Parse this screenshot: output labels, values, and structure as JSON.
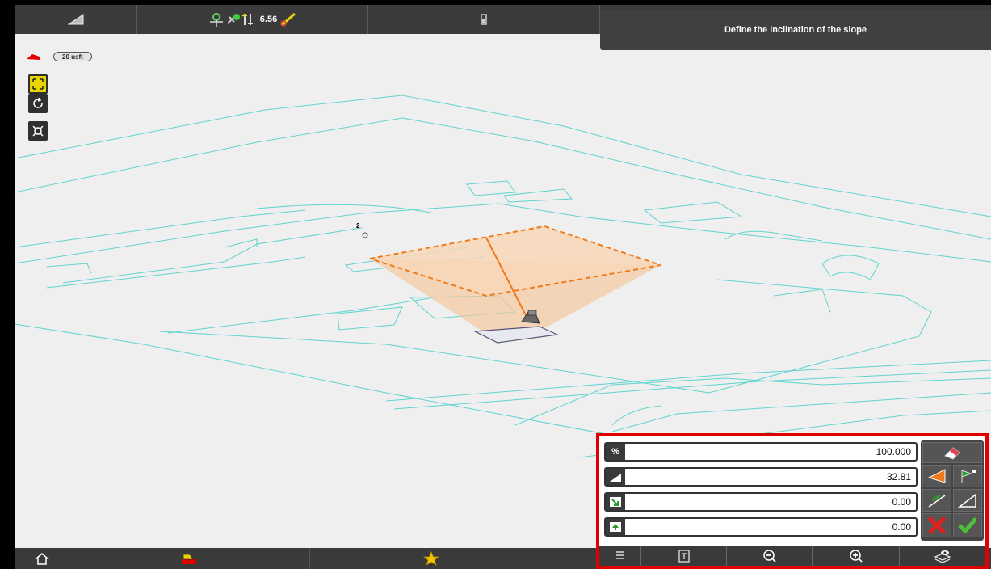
{
  "header": {
    "status_value": "6.56",
    "hint": "Define the inclination of the slope"
  },
  "scale": {
    "label": "20 usft"
  },
  "map": {
    "point_label": "2"
  },
  "slope_panel": {
    "fields": [
      {
        "icon": "percent",
        "icon_text": "%",
        "value": "100.000"
      },
      {
        "icon": "slope-angle-icon",
        "icon_text": "",
        "value": "32.81"
      },
      {
        "icon": "offset-icon",
        "icon_text": "",
        "value": "0.00"
      },
      {
        "icon": "height-icon",
        "icon_text": "",
        "value": "0.00"
      }
    ]
  },
  "colors": {
    "accent": "#e8d400",
    "highlight": "#e00000",
    "linework": "#5fd3cf",
    "slope_fill": "#f5c9a0",
    "slope_line": "#f07a1a",
    "confirm": "#4cc03a",
    "cancel": "#e02020"
  }
}
